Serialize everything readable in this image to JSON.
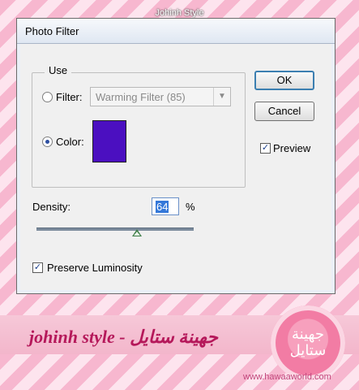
{
  "caption": "Johinh Style",
  "dialog": {
    "title": "Photo Filter",
    "use_group": {
      "label": "Use",
      "filter_label": "Filter:",
      "filter_value": "Warming Filter (85)",
      "color_label": "Color:",
      "selected": "color",
      "color_value": "#4b0fc0"
    },
    "buttons": {
      "ok": "OK",
      "cancel": "Cancel"
    },
    "preview": {
      "label": "Preview",
      "checked": true
    },
    "density": {
      "label": "Density:",
      "value": "64",
      "unit": "%"
    },
    "preserve_luminosity": {
      "label": "Preserve Luminosity",
      "checked": true
    }
  },
  "footer": {
    "text": "johinh style - جهينة ستايل",
    "badge": "جهينة\nستايل",
    "url": "www.hawaaworld.com"
  },
  "colors": {
    "accent": "#3478d9",
    "brand_pink": "#b5185a"
  }
}
